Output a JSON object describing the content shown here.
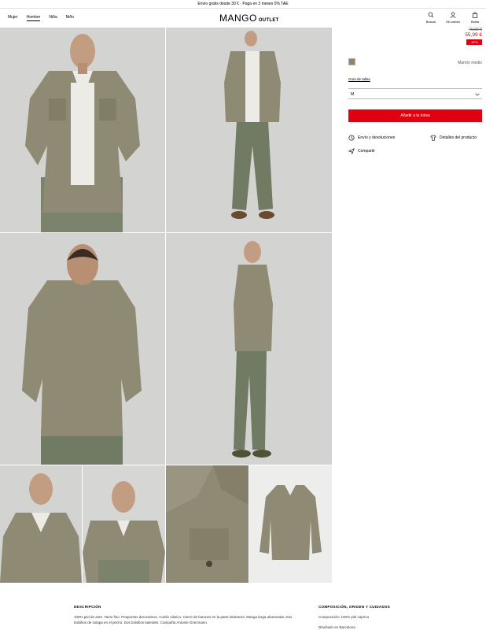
{
  "promo": "Envío gratis desde 30 € · Paga en 3 meses 0% TAE",
  "nav": {
    "links": [
      "Mujer",
      "Hombre",
      "Niña",
      "Niño"
    ],
    "logo_brand": "MANGO",
    "logo_sub": "OUTLET",
    "icons": [
      {
        "label": "Buscar",
        "icon": "search-icon"
      },
      {
        "label": "Mi cuenta",
        "icon": "user-icon"
      },
      {
        "label": "Bolsa",
        "icon": "bag-icon"
      }
    ]
  },
  "product": {
    "old_price": "79,99 €",
    "price": "55,99 €",
    "discount": "-67%",
    "color_name": "Marrón medio",
    "size_guide": "Guía de tallas",
    "size_selected": "M",
    "add_to_bag": "Añadir a la bolsa",
    "shipping": "Envío y devoluciones",
    "details": "Detalles del producto",
    "share": "Compartir"
  },
  "description": {
    "heading": "DESCRIPCIÓN",
    "text": "100% piel de ante. Tacto fino. Pespuntes decorativos. Cuello clásico. Cierre de botones en la parte delantera. Manga larga abotonada. Dos bolsillos de solapa en el pecho. Dos bolsillos laterales. Campaña Antoine Griezmann."
  },
  "composition": {
    "heading": "COMPOSICIÓN, ORIGEN Y CUIDADOS",
    "composition": "Composición: 100% piel caprino",
    "origin": "Diseñado en Barcelona"
  },
  "colors": {
    "accent": "#e1000f",
    "jacket": "#8f8a73",
    "background": "#d3d4d1"
  }
}
